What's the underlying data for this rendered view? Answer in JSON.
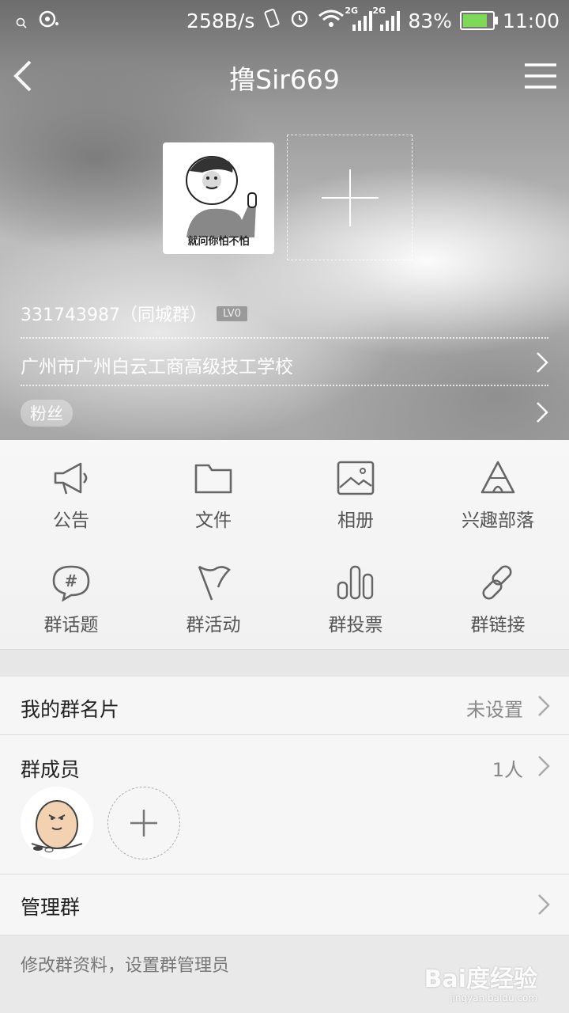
{
  "status_bar": {
    "net_speed": "258B/s",
    "signal1": "2G",
    "signal2": "2G",
    "battery": "83%",
    "time": "11:00",
    "battery_level": 0.83
  },
  "nav": {
    "title": "撸Sir669"
  },
  "group_header": {
    "avatar_caption": "就问你怕不怕",
    "group_id_text": "331743987（同城群）",
    "level_badge": "LV0",
    "location": "广州市广州白云工商高级技工学校",
    "fans_tag": "粉丝"
  },
  "features": [
    {
      "label": "公告",
      "icon": "megaphone-icon"
    },
    {
      "label": "文件",
      "icon": "folder-icon"
    },
    {
      "label": "相册",
      "icon": "photo-album-icon"
    },
    {
      "label": "兴趣部落",
      "icon": "tribe-icon"
    },
    {
      "label": "群话题",
      "icon": "topic-hashtag-icon"
    },
    {
      "label": "群活动",
      "icon": "flag-icon"
    },
    {
      "label": "群投票",
      "icon": "vote-bars-icon"
    },
    {
      "label": "群链接",
      "icon": "link-icon"
    }
  ],
  "settings": {
    "card_label": "我的群名片",
    "card_value": "未设置",
    "members_label": "群成员",
    "members_count": "1人",
    "manage_label": "管理群",
    "manage_note": "修改群资料，设置群管理员"
  },
  "watermark": {
    "brand": "Bai度经验",
    "url": "jingyan.baidu.com"
  }
}
